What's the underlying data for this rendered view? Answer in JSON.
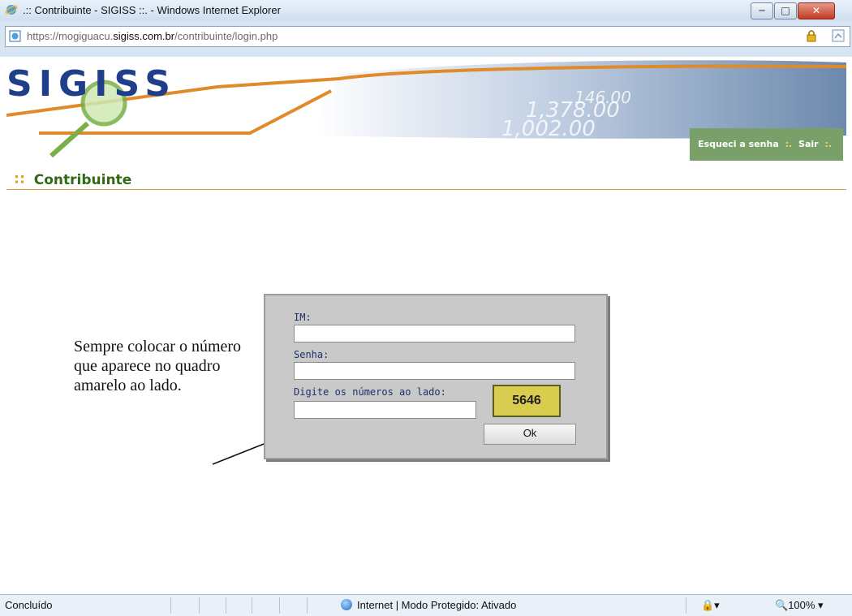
{
  "window": {
    "title": ".:: Contribuinte - SIGISS ::. - Windows Internet Explorer",
    "min_label": "─",
    "max_label": "□",
    "close_label": "✕"
  },
  "address": {
    "scheme": "https://",
    "subdomain": "mogiguacu.",
    "host": "sigiss.com.br",
    "path": "/contribuinte/login.php"
  },
  "header": {
    "logo": "SIGISS",
    "link_forgot": "Esqueci a senha",
    "link_sep": ":.",
    "link_exit": "Sair",
    "section_title": "Contribuinte",
    "banner_numbers": [
      "1,378.00",
      "1,002.00",
      "146.00"
    ]
  },
  "login": {
    "im_label": "IM:",
    "im_value": "",
    "senha_label": "Senha:",
    "senha_value": "",
    "captcha_label": "Digite os números ao lado:",
    "captcha_value": "",
    "captcha_image_text": "5646",
    "ok_label": "Ok"
  },
  "annotation": {
    "text": "Sempre colocar o número que aparece no quadro amarelo ao lado."
  },
  "status": {
    "left": "Concluído",
    "zone": "Internet | Modo Protegido: Ativado",
    "zoom": "100%"
  },
  "colors": {
    "title_green": "#2f6a12",
    "accent_orange": "#e69a17",
    "captcha_yellow": "#d8cd4f"
  }
}
